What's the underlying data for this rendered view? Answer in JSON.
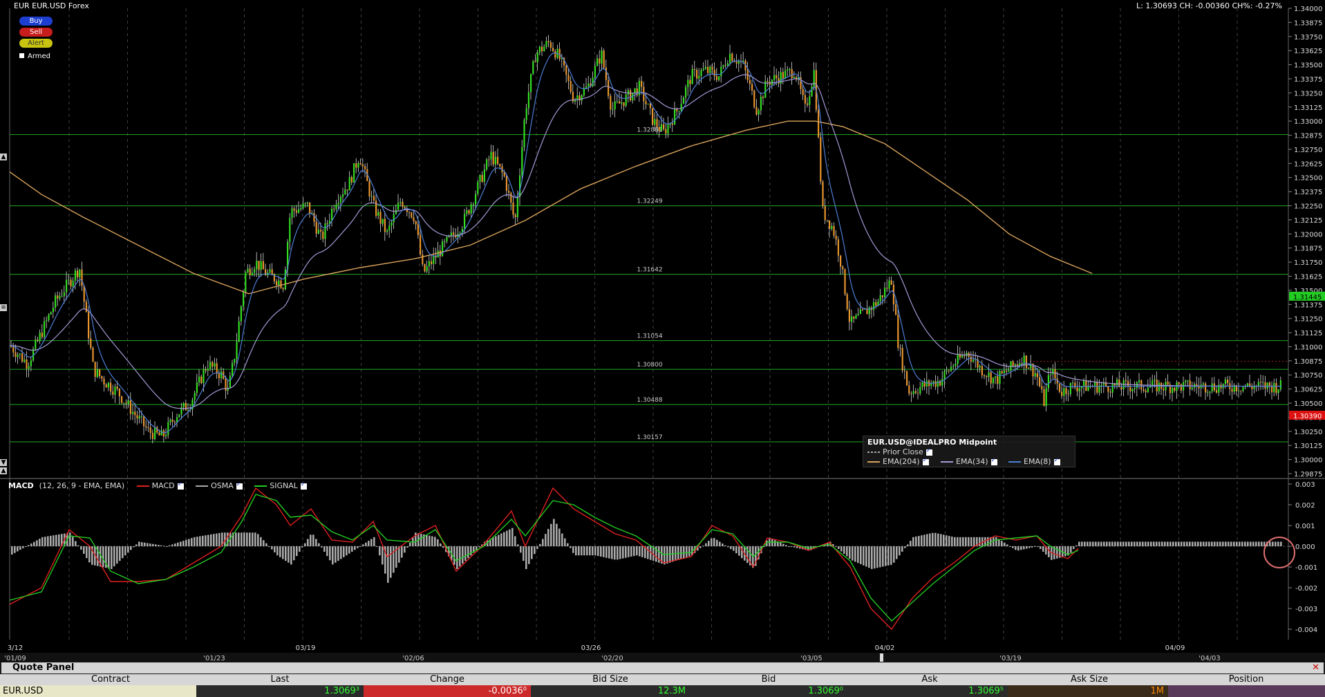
{
  "header": {
    "title": "EUR EUR.USD Forex",
    "stats": "L: 1.30693 CH: -0.00360 CH%: -0.27%"
  },
  "buttons": {
    "buy": "Buy",
    "sell": "Sell",
    "alert": "Alert",
    "armed": "Armed"
  },
  "colors": {
    "bull": "#33dd22",
    "bear": "#e8952e",
    "ema204": "#d9a35c",
    "ema34": "#a79ad8",
    "ema8": "#4d7fd6",
    "macd": "#e02020",
    "signal": "#22cc22",
    "osma": "#aaaaaa",
    "hline": "#22aa22",
    "last_price_bg": "#22cc22",
    "prior_close_bg": "#dd1111"
  },
  "chart_data": [
    {
      "type": "candlestick",
      "title": "EUR EUR.USD Forex",
      "ylim": [
        1.29875,
        1.34
      ],
      "y_ticks": [
        "1.34000",
        "1.33875",
        "1.33750",
        "1.33625",
        "1.33500",
        "1.33375",
        "1.33250",
        "1.33125",
        "1.33000",
        "1.32875",
        "1.32750",
        "1.32625",
        "1.32500",
        "1.32375",
        "1.32250",
        "1.32125",
        "1.32000",
        "1.31875",
        "1.31750",
        "1.31625",
        "1.31500",
        "1.31375",
        "1.31250",
        "1.31125",
        "1.31000",
        "1.30875",
        "1.30750",
        "1.30625",
        "1.30500",
        "1.30375",
        "1.30250",
        "1.30125",
        "1.30000",
        "1.29875"
      ],
      "horizontal_lines": [
        {
          "value": 1.32881,
          "label": "1.32881"
        },
        {
          "value": 1.32249,
          "label": "1.32249"
        },
        {
          "value": 1.31642,
          "label": "1.31642"
        },
        {
          "value": 1.31054,
          "label": "1.31054"
        },
        {
          "value": 1.308,
          "label": "1.30800"
        },
        {
          "value": 1.30488,
          "label": "1.30488"
        },
        {
          "value": 1.30157,
          "label": "1.30157"
        }
      ],
      "last_price": {
        "value": 1.31445,
        "label": "1.31445"
      },
      "prior_close": {
        "value": 1.3039,
        "label": "1.30390"
      },
      "x_labels_top": [
        "3/12",
        "03/19",
        "03/26",
        "04/02",
        "04/09"
      ],
      "x_labels_bottom": [
        "'01/09",
        "'01/23",
        "'02/06",
        "'02/20",
        "'03/05",
        "'03/19",
        "'04/03"
      ],
      "close_path": [
        [
          0,
          1.311
        ],
        [
          40,
          1.3085
        ],
        [
          80,
          1.314
        ],
        [
          115,
          1.317
        ],
        [
          135,
          1.308
        ],
        [
          150,
          1.307
        ],
        [
          170,
          1.306
        ],
        [
          195,
          1.304
        ],
        [
          215,
          1.3025
        ],
        [
          235,
          1.302
        ],
        [
          255,
          1.304
        ],
        [
          275,
          1.305
        ],
        [
          300,
          1.3085
        ],
        [
          320,
          1.3075
        ],
        [
          330,
          1.306
        ],
        [
          340,
          1.3095
        ],
        [
          355,
          1.3165
        ],
        [
          370,
          1.3175
        ],
        [
          385,
          1.3165
        ],
        [
          400,
          1.316
        ],
        [
          410,
          1.3155
        ],
        [
          420,
          1.322
        ],
        [
          445,
          1.3225
        ],
        [
          465,
          1.3195
        ],
        [
          485,
          1.323
        ],
        [
          505,
          1.3245
        ],
        [
          520,
          1.327
        ],
        [
          540,
          1.3225
        ],
        [
          560,
          1.32
        ],
        [
          580,
          1.323
        ],
        [
          600,
          1.3215
        ],
        [
          612,
          1.3165
        ],
        [
          630,
          1.318
        ],
        [
          650,
          1.3195
        ],
        [
          670,
          1.321
        ],
        [
          690,
          1.324
        ],
        [
          710,
          1.327
        ],
        [
          730,
          1.325
        ],
        [
          745,
          1.321
        ],
        [
          760,
          1.331
        ],
        [
          775,
          1.336
        ],
        [
          795,
          1.337
        ],
        [
          810,
          1.3355
        ],
        [
          830,
          1.332
        ],
        [
          850,
          1.333
        ],
        [
          870,
          1.336
        ],
        [
          885,
          1.331
        ],
        [
          905,
          1.332
        ],
        [
          925,
          1.333
        ],
        [
          945,
          1.33
        ],
        [
          960,
          1.329
        ],
        [
          980,
          1.331
        ],
        [
          1000,
          1.334
        ],
        [
          1020,
          1.3345
        ],
        [
          1040,
          1.334
        ],
        [
          1055,
          1.336
        ],
        [
          1075,
          1.335
        ],
        [
          1095,
          1.331
        ],
        [
          1110,
          1.3335
        ],
        [
          1130,
          1.334
        ],
        [
          1150,
          1.3345
        ],
        [
          1165,
          1.331
        ],
        [
          1178,
          1.3345
        ],
        [
          1190,
          1.322
        ],
        [
          1205,
          1.3205
        ],
        [
          1215,
          1.318
        ],
        [
          1230,
          1.312
        ],
        [
          1250,
          1.313
        ],
        [
          1270,
          1.314
        ],
        [
          1290,
          1.316
        ],
        [
          1300,
          1.31
        ],
        [
          1315,
          1.306
        ],
        [
          1335,
          1.3065
        ],
        [
          1360,
          1.307
        ],
        [
          1380,
          1.3085
        ],
        [
          1400,
          1.3095
        ],
        [
          1420,
          1.308
        ],
        [
          1440,
          1.307
        ],
        [
          1460,
          1.308
        ],
        [
          1480,
          1.309
        ],
        [
          1500,
          1.3075
        ],
        [
          1510,
          1.305
        ],
        [
          1520,
          1.308
        ],
        [
          1535,
          1.306
        ],
        [
          1550,
          1.3065
        ]
      ],
      "ema204_path": [
        [
          14,
          1.3255
        ],
        [
          60,
          1.3235
        ],
        [
          120,
          1.3215
        ],
        [
          200,
          1.319
        ],
        [
          280,
          1.3165
        ],
        [
          360,
          1.3147
        ],
        [
          440,
          1.316
        ],
        [
          520,
          1.317
        ],
        [
          600,
          1.3178
        ],
        [
          680,
          1.319
        ],
        [
          760,
          1.3212
        ],
        [
          840,
          1.324
        ],
        [
          920,
          1.326
        ],
        [
          1000,
          1.3278
        ],
        [
          1080,
          1.3292
        ],
        [
          1140,
          1.33
        ],
        [
          1180,
          1.33
        ],
        [
          1220,
          1.3295
        ],
        [
          1280,
          1.328
        ],
        [
          1340,
          1.3255
        ],
        [
          1400,
          1.323
        ],
        [
          1460,
          1.32
        ],
        [
          1520,
          1.318
        ],
        [
          1560,
          1.317
        ],
        [
          1580,
          1.3165
        ]
      ],
      "series": [
        {
          "name": "EMA(204)"
        },
        {
          "name": "EMA(34)"
        },
        {
          "name": "EMA(8)"
        }
      ],
      "legend": {
        "title": "EUR.USD@IDEALPRO Midpoint",
        "items": [
          "Prior Close",
          "EMA(204)",
          "EMA(34)",
          "EMA(8)"
        ]
      }
    },
    {
      "type": "line",
      "title": "MACD",
      "subtitle": "(12, 26, 9 - EMA, EMA)",
      "ylim": [
        -0.0045,
        0.003
      ],
      "y_ticks": [
        "0.003",
        "0.002",
        "0.001",
        "0.000",
        "-0.001",
        "-0.002",
        "-0.003",
        "-0.004"
      ],
      "series": [
        {
          "name": "MACD",
          "points": [
            [
              14,
              -0.0028
            ],
            [
              60,
              -0.002
            ],
            [
              100,
              0.0008
            ],
            [
              130,
              0.0
            ],
            [
              160,
              -0.0017
            ],
            [
              200,
              -0.0017
            ],
            [
              240,
              -0.0016
            ],
            [
              280,
              -0.0008
            ],
            [
              320,
              0.0
            ],
            [
              350,
              0.0015
            ],
            [
              370,
              0.0028
            ],
            [
              400,
              0.002
            ],
            [
              420,
              0.001
            ],
            [
              450,
              0.0018
            ],
            [
              480,
              0.0003
            ],
            [
              510,
              0.0002
            ],
            [
              540,
              0.0012
            ],
            [
              560,
              -0.0005
            ],
            [
              600,
              0.0005
            ],
            [
              630,
              0.001
            ],
            [
              660,
              -0.0012
            ],
            [
              700,
              0.0001
            ],
            [
              740,
              0.0017
            ],
            [
              760,
              0.0
            ],
            [
              800,
              0.0028
            ],
            [
              830,
              0.0018
            ],
            [
              860,
              0.0012
            ],
            [
              890,
              0.0006
            ],
            [
              920,
              0.0003
            ],
            [
              960,
              -0.0008
            ],
            [
              1000,
              -0.0005
            ],
            [
              1030,
              0.001
            ],
            [
              1060,
              0.0005
            ],
            [
              1090,
              -0.001
            ],
            [
              1110,
              0.0004
            ],
            [
              1140,
              0.0002
            ],
            [
              1170,
              -0.0002
            ],
            [
              1200,
              0.0002
            ],
            [
              1230,
              -0.001
            ],
            [
              1260,
              -0.003
            ],
            [
              1290,
              -0.004
            ],
            [
              1320,
              -0.0025
            ],
            [
              1350,
              -0.0015
            ],
            [
              1380,
              -0.0008
            ],
            [
              1410,
              0.0
            ],
            [
              1440,
              0.0005
            ],
            [
              1470,
              0.0003
            ],
            [
              1500,
              0.0005
            ],
            [
              1520,
              -0.0003
            ],
            [
              1545,
              -0.0006
            ],
            [
              1560,
              -0.0001
            ]
          ]
        },
        {
          "name": "SIGNAL",
          "points": [
            [
              14,
              -0.0026
            ],
            [
              60,
              -0.0022
            ],
            [
              100,
              0.0005
            ],
            [
              130,
              0.0004
            ],
            [
              160,
              -0.0012
            ],
            [
              200,
              -0.0018
            ],
            [
              240,
              -0.0016
            ],
            [
              280,
              -0.001
            ],
            [
              320,
              -0.0003
            ],
            [
              350,
              0.0012
            ],
            [
              370,
              0.0025
            ],
            [
              400,
              0.0022
            ],
            [
              420,
              0.0014
            ],
            [
              450,
              0.0015
            ],
            [
              480,
              0.0007
            ],
            [
              510,
              0.0003
            ],
            [
              540,
              0.001
            ],
            [
              560,
              0.0003
            ],
            [
              600,
              0.0002
            ],
            [
              630,
              0.0008
            ],
            [
              660,
              -0.0007
            ],
            [
              700,
              0.0
            ],
            [
              740,
              0.0013
            ],
            [
              760,
              0.0005
            ],
            [
              800,
              0.0022
            ],
            [
              830,
              0.002
            ],
            [
              860,
              0.0014
            ],
            [
              890,
              0.0009
            ],
            [
              920,
              0.0005
            ],
            [
              960,
              -0.0004
            ],
            [
              1000,
              -0.0003
            ],
            [
              1030,
              0.0008
            ],
            [
              1060,
              0.0006
            ],
            [
              1090,
              -0.0005
            ],
            [
              1110,
              0.0002
            ],
            [
              1140,
              0.0002
            ],
            [
              1170,
              -0.0001
            ],
            [
              1200,
              0.0001
            ],
            [
              1230,
              -0.0007
            ],
            [
              1260,
              -0.0025
            ],
            [
              1290,
              -0.0036
            ],
            [
              1320,
              -0.0027
            ],
            [
              1350,
              -0.0018
            ],
            [
              1380,
              -0.001
            ],
            [
              1410,
              -0.0002
            ],
            [
              1440,
              0.0003
            ],
            [
              1470,
              0.0004
            ],
            [
              1500,
              0.0005
            ],
            [
              1520,
              0.0
            ],
            [
              1545,
              -0.0004
            ],
            [
              1560,
              -0.0002
            ]
          ]
        }
      ],
      "legend": [
        "MACD",
        "OSMA",
        "SIGNAL"
      ]
    }
  ],
  "quote_panel": {
    "title": "Quote Panel",
    "columns": [
      "Contract",
      "Last",
      "Change",
      "Bid Size",
      "Bid",
      "Ask",
      "Ask Size",
      "Position"
    ],
    "row": {
      "contract": "EUR.USD",
      "last": "1.3069³",
      "change": "-0.0036⁰",
      "bid_size": "12.3M",
      "bid": "1.3069⁰",
      "ask": "1.3069⁵",
      "ask_size": "1M",
      "position": ""
    }
  }
}
